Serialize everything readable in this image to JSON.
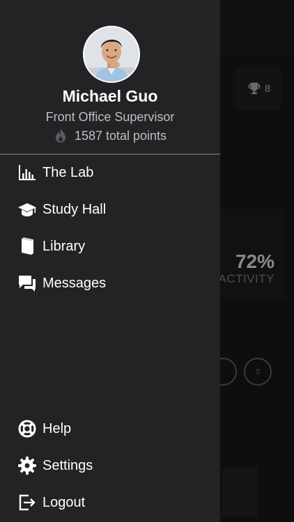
{
  "profile": {
    "name": "Michael Guo",
    "role": "Front Office Supervisor",
    "points": "1587 total points"
  },
  "menu": {
    "lab": "The Lab",
    "study_hall": "Study Hall",
    "library": "Library",
    "messages": "Messages",
    "help": "Help",
    "settings": "Settings",
    "logout": "Logout"
  },
  "background": {
    "trophy_count": "8",
    "activity_value": "72%",
    "activity_label": "ACTIVITY",
    "circle_1": "",
    "circle_2": "S"
  },
  "icons": {
    "lab": "bar-chart-icon",
    "study_hall": "graduation-cap-icon",
    "library": "book-icon",
    "messages": "chat-bubbles-icon",
    "help": "lifebuoy-icon",
    "settings": "gear-icon",
    "logout": "logout-icon",
    "points": "flame-icon",
    "trophy": "trophy-icon"
  },
  "colors": {
    "drawer_bg": "#232326",
    "page_bg": "#0c0c0d",
    "text_primary": "#ffffff",
    "text_secondary": "#bfbfc3",
    "divider": "#8a8a8f"
  }
}
